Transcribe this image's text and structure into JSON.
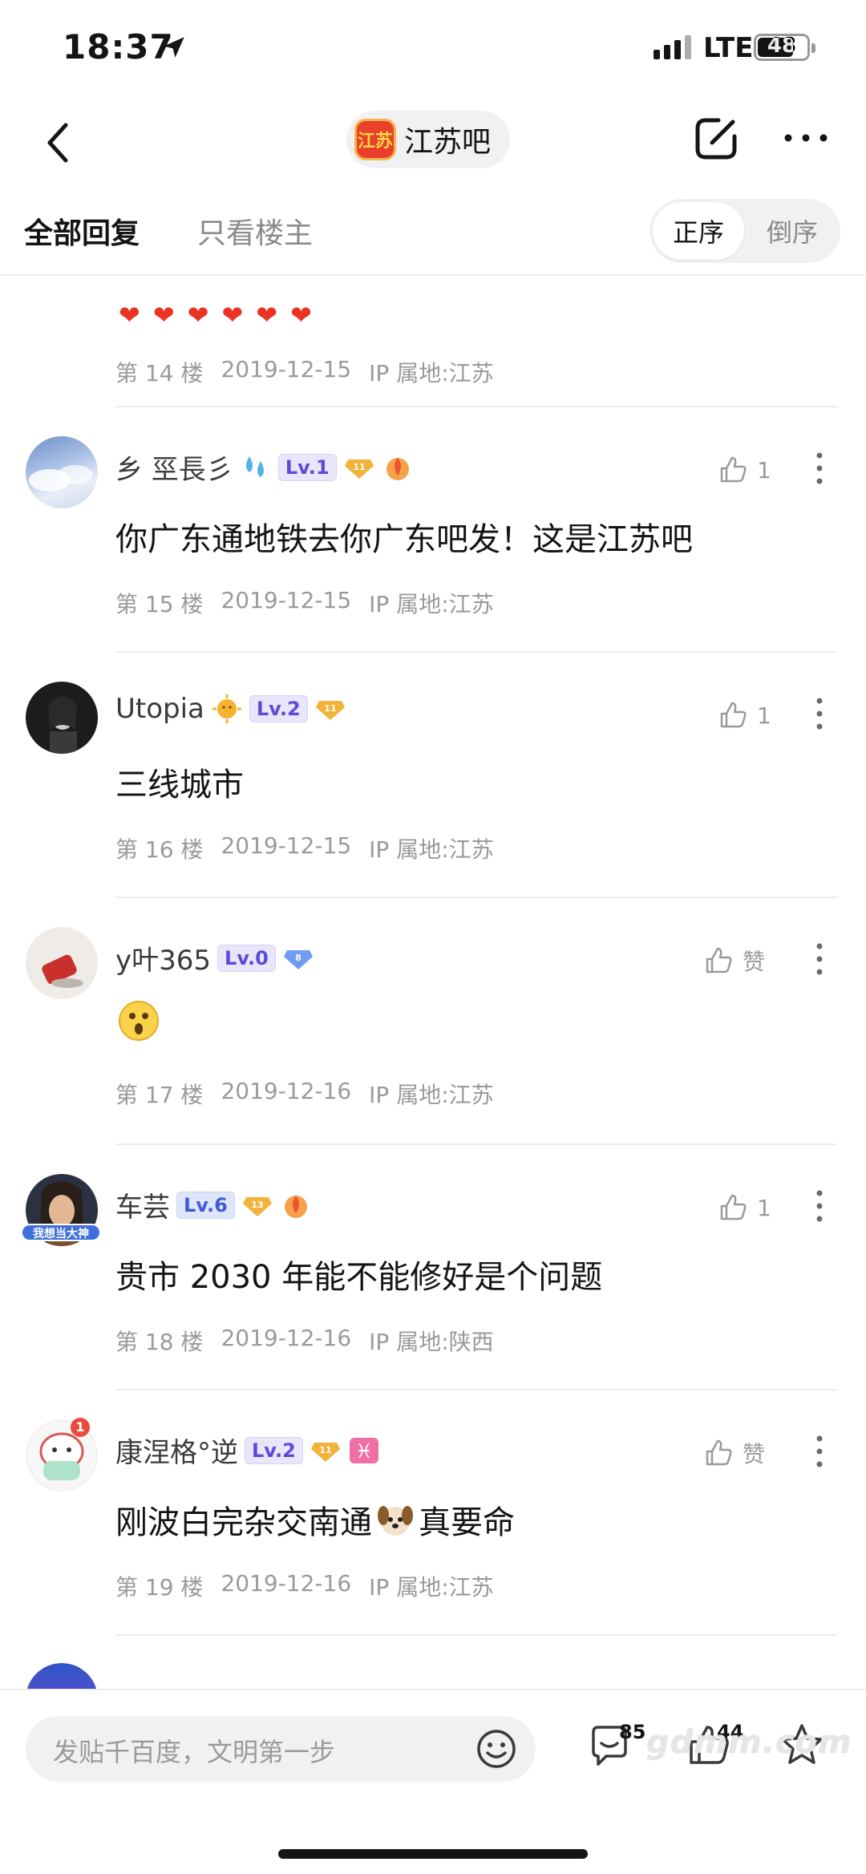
{
  "status_bar": {
    "time": "18:37",
    "network": "LTE",
    "battery": "48"
  },
  "nav": {
    "forum_logo_text": "江苏",
    "forum_name": "江苏吧"
  },
  "filter": {
    "all_replies": "全部回复",
    "only_op": "只看楼主",
    "order_asc": "正序",
    "order_desc": "倒序"
  },
  "top_post": {
    "hearts": [
      "❤",
      "❤",
      "❤",
      "❤",
      "❤",
      "❤"
    ],
    "floor": "第 14 楼",
    "date": "2019-12-15",
    "ip": "IP 属地:江苏"
  },
  "posts": [
    {
      "user": "乡 巠長彡",
      "level": "Lv.1",
      "badge": "11",
      "text": "你广东通地铁去你广东吧发！这是江苏吧",
      "likes": "1",
      "floor": "第 15 楼",
      "date": "2019-12-15",
      "ip": "IP 属地:江苏"
    },
    {
      "user": "Utopia",
      "level": "Lv.2",
      "badge": "11",
      "text": "三线城市",
      "likes": "1",
      "floor": "第 16 楼",
      "date": "2019-12-15",
      "ip": "IP 属地:江苏"
    },
    {
      "user": "y叶365",
      "level": "Lv.0",
      "badge": "8",
      "text": "",
      "likes": "赞",
      "floor": "第 17 楼",
      "date": "2019-12-16",
      "ip": "IP 属地:江苏"
    },
    {
      "user": "车芸",
      "level": "Lv.6",
      "badge": "13",
      "text": "贵市 2030 年能不能修好是个问题",
      "likes": "1",
      "floor": "第 18 楼",
      "date": "2019-12-16",
      "ip": "IP 属地:陕西",
      "avatar_caption": "我想当大神"
    },
    {
      "user": "康涅格°逆",
      "level": "Lv.2",
      "badge": "11",
      "text": "刚波白完杂交南通",
      "text_after": "真要命",
      "likes": "赞",
      "floor": "第 19 楼",
      "date": "2019-12-16",
      "ip": "IP 属地:江苏",
      "avatar_badge": "1"
    }
  ],
  "bottom_bar": {
    "placeholder": "发贴千百度，文明第一步",
    "comment_count": "85",
    "like_count": "44"
  },
  "watermark": "gdmm.com",
  "icons": {
    "back": "chevron-left-icon",
    "edit": "edit-icon",
    "more": "more-horizontal-icon",
    "like": "thumb-up-icon",
    "post_more": "more-vertical-icon",
    "emoji": "smile-icon",
    "comment": "comment-icon",
    "favorite": "star-icon"
  },
  "colors": {
    "level_bg": "#e9e6fb",
    "level_text": "#5b4bd6",
    "heart": "#ea3323",
    "forum_logo": "#e8402a"
  }
}
